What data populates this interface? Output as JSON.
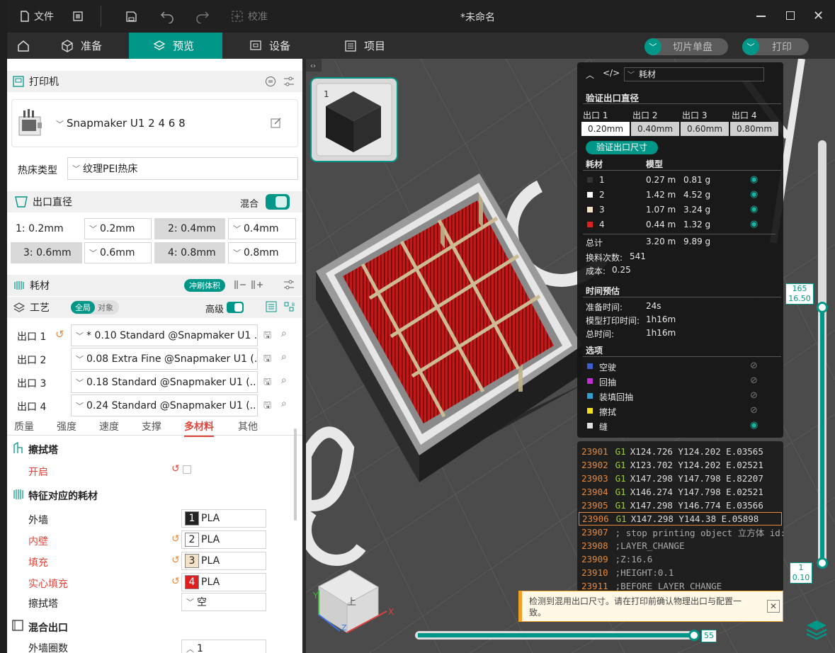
{
  "titlebar": {
    "file_label": "文件",
    "calibrate_label": "校准",
    "doc_title": "*未命名"
  },
  "nav": {
    "tabs": [
      {
        "label": "准备"
      },
      {
        "label": "预览"
      },
      {
        "label": "设备"
      },
      {
        "label": "项目"
      }
    ],
    "slice_label": "切片单盘",
    "print_label": "打印"
  },
  "printer": {
    "section": "打印机",
    "name": "Snapmaker U1 2 4 6 8",
    "bed_label": "热床类型",
    "bed_value": "纹理PEI热床"
  },
  "nozzle": {
    "section": "出口直径",
    "mix_label": "混合",
    "items": [
      {
        "label": "1: 0.2mm",
        "value": "0.2mm"
      },
      {
        "label": "2: 0.4mm",
        "value": "0.4mm"
      },
      {
        "label": "3: 0.6mm",
        "value": "0.6mm"
      },
      {
        "label": "4: 0.8mm",
        "value": "0.8mm"
      }
    ]
  },
  "filament": {
    "section": "耗材",
    "flush_label": "冲刷体积"
  },
  "process": {
    "section": "工艺",
    "global_label": "全局",
    "object_label": "对象",
    "advanced_label": "高级",
    "outputs": [
      {
        "label": "出口 1",
        "value": "* 0.10 Standard @Snapmaker U1 ..."
      },
      {
        "label": "出口 2",
        "value": "0.08 Extra Fine @Snapmaker U1 (..."
      },
      {
        "label": "出口 3",
        "value": "0.18 Standard @Snapmaker U1 (..."
      },
      {
        "label": "出口 4",
        "value": "0.24 Standard @Snapmaker U1 (..."
      }
    ],
    "tabs": [
      "质量",
      "强度",
      "速度",
      "支撑",
      "多材料",
      "其他"
    ],
    "wipe_tower_section": "擦拭塔",
    "enable_label": "开启",
    "feature_section": "特征对应的耗材",
    "features": [
      {
        "label": "外墙",
        "num": "1",
        "mat": "PLA"
      },
      {
        "label": "内壁",
        "num": "2",
        "mat": "PLA"
      },
      {
        "label": "填充",
        "num": "3",
        "mat": "PLA"
      },
      {
        "label": "实心填充",
        "num": "4",
        "mat": "PLA"
      }
    ],
    "wipe_tower_label": "擦拭塔",
    "wipe_tower_value": "空",
    "mixed_section": "混合出口",
    "outer_wall_label": "外墙圈数",
    "outer_wall_value": "1"
  },
  "stats": {
    "dropdown": "耗材",
    "verify_title": "验证出口直径",
    "outlets": [
      {
        "label": "出口 1",
        "value": "0.20mm"
      },
      {
        "label": "出口 2",
        "value": "0.40mm"
      },
      {
        "label": "出口 3",
        "value": "0.60mm"
      },
      {
        "label": "出口 4",
        "value": "0.80mm"
      }
    ],
    "verify_btn": "验证出口尺寸",
    "col_filament": "耗材",
    "col_model": "模型",
    "rows": [
      {
        "id": "1",
        "len": "0.27 m",
        "weight": "0.81 g",
        "color": "#333333"
      },
      {
        "id": "2",
        "len": "1.42 m",
        "weight": "4.52 g",
        "color": "#ffffff"
      },
      {
        "id": "3",
        "len": "1.07 m",
        "weight": "3.24 g",
        "color": "#f3e2c7"
      },
      {
        "id": "4",
        "len": "0.44 m",
        "weight": "1.32 g",
        "color": "#e02020"
      }
    ],
    "total_label": "总计",
    "total_len": "3.20 m",
    "total_weight": "9.89 g",
    "swap_label": "换料次数:",
    "swap_value": "541",
    "cost_label": "成本:",
    "cost_value": "0.25",
    "time_title": "时间预估",
    "prep_label": "准备时间:",
    "prep_value": "24s",
    "model_time_label": "模型打印时间:",
    "model_time_value": "1h16m",
    "total_time_label": "总时间:",
    "total_time_value": "1h16m",
    "options_title": "选项",
    "options": [
      {
        "label": "空驶",
        "color": "#3a5fd0"
      },
      {
        "label": "回抽",
        "color": "#c030d0"
      },
      {
        "label": "装填回抽",
        "color": "#30a0d0"
      },
      {
        "label": "擦拭",
        "color": "#f0e020"
      },
      {
        "label": "缝",
        "color": "#e0e0e0"
      }
    ]
  },
  "gcode": [
    {
      "n": "23901",
      "cmd": "G1",
      "args": "X124.726 Y124.202 E.03565"
    },
    {
      "n": "23902",
      "cmd": "G1",
      "args": "X123.702 Y124.202 E.02521"
    },
    {
      "n": "23903",
      "cmd": "G1",
      "args": "X147.298 Y147.798 E.82207"
    },
    {
      "n": "23904",
      "cmd": "G1",
      "args": "X146.274 Y147.798 E.02521"
    },
    {
      "n": "23905",
      "cmd": "G1",
      "args": "X147.298 Y146.774 E.03566"
    },
    {
      "n": "23906",
      "cmd": "G1",
      "args": "X147.298 Y144.38 E.05898"
    },
    {
      "n": "23907",
      "cmd": "",
      "args": "; stop printing object 立方体 id:0 copy 0"
    },
    {
      "n": "23908",
      "cmd": "",
      "args": ";LAYER_CHANGE"
    },
    {
      "n": "23909",
      "cmd": "",
      "args": ";Z:16.6"
    },
    {
      "n": "23910",
      "cmd": "",
      "args": ";HEIGHT:0.1"
    },
    {
      "n": "23911",
      "cmd": "",
      "args": ";BEFORE_LAYER_CHANGE"
    }
  ],
  "slider": {
    "top_layer": "165",
    "top_height": "16.50",
    "bottom_layer": "1",
    "bottom_height": "0.10",
    "horiz_value": "55"
  },
  "notice": "检测到混用出口尺寸。请在打印前确认物理出口与配置一致。",
  "thumb_index": "1",
  "cube_top_label": "上"
}
